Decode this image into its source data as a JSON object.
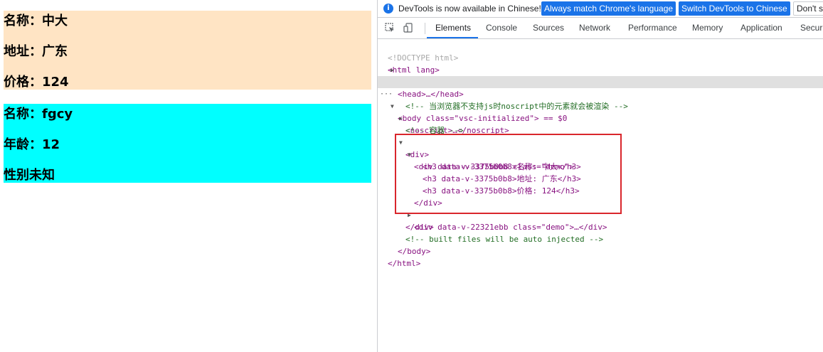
{
  "page": {
    "demo1": {
      "lines": [
        "名称：中大",
        "地址：广东",
        "价格：124"
      ],
      "bg": "#ffe4c4"
    },
    "demo2": {
      "lines": [
        "名称：fgcy",
        "年龄：12",
        "性别未知"
      ],
      "bg": "#00ffff"
    }
  },
  "devtools": {
    "infobar": {
      "icon": "info-icon",
      "message": "DevTools is now available in Chinese!",
      "btn_match": "Always match Chrome's language",
      "btn_switch": "Switch DevTools to Chinese",
      "btn_dont": "Don't s"
    },
    "toolbar": {
      "inspect_icon": "inspect-element-icon",
      "device_icon": "device-toggle-icon",
      "tabs": [
        "Elements",
        "Console",
        "Sources",
        "Network",
        "Performance",
        "Memory",
        "Application",
        "Securi"
      ]
    },
    "elements": {
      "doctype": "<!DOCTYPE html>",
      "html_open": "<html lang>",
      "head": "<head>…</head>",
      "body_tag": "<body class=\"vsc-initialized\"> == $0",
      "comment_noscript": "<!-- 当浏览器不支持js时noscript中的元素就会被渲染 -->",
      "noscript": "<noscript>…</noscript>",
      "comment_container": "<!-- 容器 -->",
      "div_open": "<div>",
      "demo1_open": "<div data-v-3375b0b8 class=\"demo\">",
      "h3_1": "<h3 data-v-3375b0b8>名称: 中大</h3>",
      "h3_2": "<h3 data-v-3375b0b8>地址: 广东</h3>",
      "h3_3": "<h3 data-v-3375b0b8>价格: 124</h3>",
      "div_close_inner": "</div>",
      "demo2_collapsed": "<div data-v-22321ebb class=\"demo\">…</div>",
      "div_close": "</div>",
      "comment_built": "<!-- built files will be auto injected -->",
      "body_close": "</body>",
      "html_close": "</html>"
    }
  }
}
